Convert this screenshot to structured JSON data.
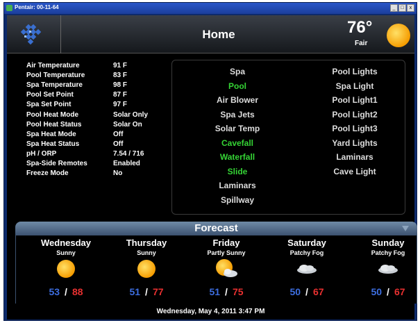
{
  "window": {
    "title": "Pentair: 00-11-64",
    "buttons": {
      "minimize": "_",
      "maximize": "□",
      "close": "x"
    }
  },
  "header": {
    "title": "Home",
    "current_temp": "76°",
    "current_condition": "Fair",
    "weather_icon": "sun-icon"
  },
  "status": [
    {
      "label": "Air Temperature",
      "value": "91 F"
    },
    {
      "label": "Pool Temperature",
      "value": "83 F"
    },
    {
      "label": "Spa Temperature",
      "value": "98 F"
    },
    {
      "label": "Pool Set Point",
      "value": "87 F"
    },
    {
      "label": "Spa Set Point",
      "value": "97 F"
    },
    {
      "label": "Pool Heat Mode",
      "value": "Solar Only"
    },
    {
      "label": "Pool Heat Status",
      "value": "Solar On"
    },
    {
      "label": "Spa Heat Mode",
      "value": "Off"
    },
    {
      "label": "Spa Heat Status",
      "value": "Off"
    },
    {
      "label": "pH / ORP",
      "value": "7.54 / 716"
    },
    {
      "label": "Spa-Side Remotes",
      "value": "Enabled"
    },
    {
      "label": "Freeze Mode",
      "value": "No"
    }
  ],
  "controls": {
    "left": [
      {
        "label": "Spa",
        "on": false
      },
      {
        "label": "Pool",
        "on": true
      },
      {
        "label": "Air Blower",
        "on": false
      },
      {
        "label": "Spa Jets",
        "on": false
      },
      {
        "label": "Solar Temp",
        "on": false
      },
      {
        "label": "Cavefall",
        "on": true
      },
      {
        "label": "Waterfall",
        "on": true
      },
      {
        "label": "Slide",
        "on": true
      },
      {
        "label": "Laminars",
        "on": false
      },
      {
        "label": "Spillway",
        "on": false
      }
    ],
    "right": [
      {
        "label": "Pool Lights",
        "on": false
      },
      {
        "label": "Spa Light",
        "on": false
      },
      {
        "label": "Pool Light1",
        "on": false
      },
      {
        "label": "Pool Light2",
        "on": false
      },
      {
        "label": "Pool Light3",
        "on": false
      },
      {
        "label": "Yard Lights",
        "on": false
      },
      {
        "label": "Laminars",
        "on": false
      },
      {
        "label": "Cave Light",
        "on": false
      }
    ]
  },
  "forecast": {
    "title": "Forecast",
    "days": [
      {
        "day": "Wednesday",
        "condition": "Sunny",
        "icon": "sun-icon",
        "low": "53",
        "high": "88"
      },
      {
        "day": "Thursday",
        "condition": "Sunny",
        "icon": "sun-icon",
        "low": "51",
        "high": "77"
      },
      {
        "day": "Friday",
        "condition": "Partly Sunny",
        "icon": "partly-sunny-icon",
        "low": "51",
        "high": "75"
      },
      {
        "day": "Saturday",
        "condition": "Patchy Fog",
        "icon": "fog-icon",
        "low": "50",
        "high": "67"
      },
      {
        "day": "Sunday",
        "condition": "Patchy Fog",
        "icon": "fog-icon",
        "low": "50",
        "high": "67"
      }
    ],
    "separator": "/"
  },
  "datetime": "Wednesday, May 4, 2011 3:47 PM",
  "colors": {
    "on": "#35d435",
    "low": "#3d6ee0",
    "high": "#e83030",
    "accent_sun": "#f5a000"
  }
}
